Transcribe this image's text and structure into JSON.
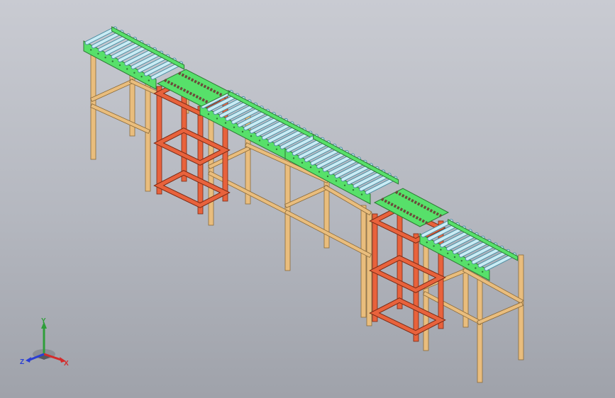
{
  "viewport": {
    "background_top": "#c9cbd2",
    "background_bottom": "#9fa2aa"
  },
  "colors": {
    "wood_leg": "#e9bd7d",
    "wood_edge": "#8a6a3a",
    "roller_frame": "#57e06a",
    "roller_frame_edge": "#2d7a35",
    "roller": "#c9ecf5",
    "roller_edge": "#4f8ea2",
    "steel_stand": "#e8623c",
    "steel_edge": "#7a2a14",
    "chain": "#6b4a3a"
  },
  "triad": {
    "y_label": "Y",
    "x_label": "X",
    "z_label": "Z",
    "y_color": "#2f9e3a",
    "x_color": "#d42a2a",
    "z_color": "#2a3ed4"
  }
}
